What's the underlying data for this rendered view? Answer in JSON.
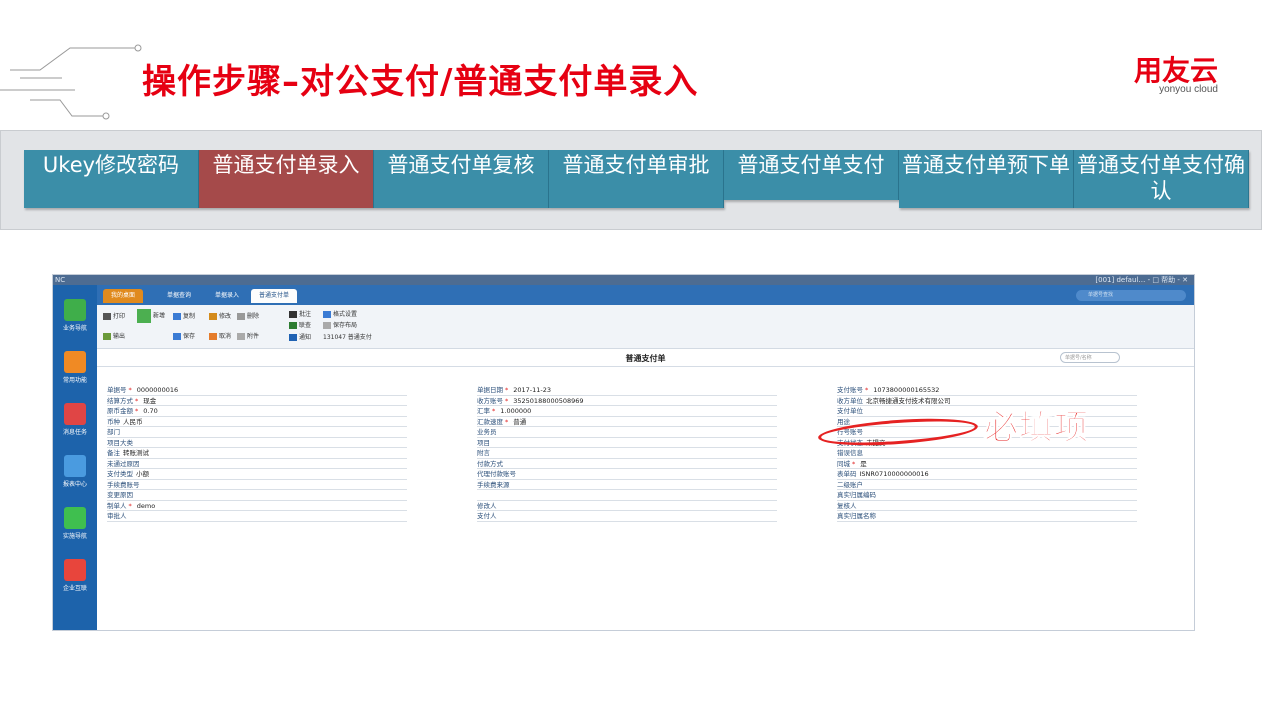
{
  "header": {
    "title": "操作步骤–对公支付/普通支付单录入",
    "logo_main": "用友云",
    "logo_sub": "yonyou cloud"
  },
  "colors": {
    "accent_red": "#e60012",
    "step_blue": "#3b8ea8",
    "step_active": "#a54a4a"
  },
  "steps": [
    {
      "label": "Ukey修改密码",
      "active": false
    },
    {
      "label": "普通支付单录入",
      "active": true
    },
    {
      "label": "普通支付单复核",
      "active": false
    },
    {
      "label": "普通支付单审批",
      "active": false
    },
    {
      "label": "普通支付单支付",
      "active": false
    },
    {
      "label": "普通支付单预下单",
      "active": false
    },
    {
      "label": "普通支付单支付确认",
      "active": false
    }
  ],
  "app": {
    "window_title": "NC",
    "top_right": "[001] defaul… - □ 帮助 - ✕",
    "sidebar": [
      "业务导航",
      "常用功能",
      "消息任务",
      "报表中心",
      "实施导航",
      "企业互联"
    ],
    "tabs": {
      "home": "我的桌面",
      "t1": "单据查询",
      "t2": "单据录入",
      "t3": "普通支付单"
    },
    "tab_search_placeholder": "单据号查找",
    "toolbar": {
      "print": "打印",
      "output": "输出",
      "new": "新增",
      "copy": "复制",
      "edit": "修改",
      "delete": "删除",
      "save": "保存",
      "cancel": "取消",
      "attach": "附件",
      "note": "批注",
      "link": "联查",
      "notice": "通知",
      "format": "格式设置",
      "save_layout": "保存布局",
      "bill": "131047 普通支付"
    },
    "form": {
      "title": "普通支付单",
      "search_placeholder": "单据号/名称",
      "col1": [
        {
          "label": "单据号",
          "req": true,
          "value": "0000000016"
        },
        {
          "label": "结算方式",
          "req": true,
          "value": "现金"
        },
        {
          "label": "原币金额",
          "req": true,
          "value": "0.70"
        },
        {
          "label": "币种",
          "req": false,
          "value": "人民币"
        },
        {
          "label": "部门",
          "req": false,
          "value": ""
        },
        {
          "label": "项目大类",
          "req": false,
          "value": ""
        },
        {
          "label": "备注",
          "req": false,
          "value": "转账测试"
        },
        {
          "label": "未通过原因",
          "req": false,
          "value": ""
        },
        {
          "label": "支付类型",
          "req": false,
          "value": "小额"
        },
        {
          "label": "手续费账号",
          "req": false,
          "value": ""
        },
        {
          "label": "变更原因",
          "req": false,
          "value": ""
        },
        {
          "label": "制单人",
          "req": true,
          "value": "demo"
        },
        {
          "label": "审批人",
          "req": false,
          "value": ""
        }
      ],
      "col2": [
        {
          "label": "单据日期",
          "req": true,
          "value": "2017-11-23"
        },
        {
          "label": "收方账号",
          "req": true,
          "value": "35250188000508969"
        },
        {
          "label": "汇率",
          "req": true,
          "value": "1.000000"
        },
        {
          "label": "汇款速度",
          "req": true,
          "value": "普通"
        },
        {
          "label": "业务员",
          "req": false,
          "value": ""
        },
        {
          "label": "项目",
          "req": false,
          "value": ""
        },
        {
          "label": "附言",
          "req": false,
          "value": ""
        },
        {
          "label": "付款方式",
          "req": false,
          "value": ""
        },
        {
          "label": "代理付款账号",
          "req": false,
          "value": ""
        },
        {
          "label": "手续费来源",
          "req": false,
          "value": ""
        },
        {
          "label": "",
          "req": false,
          "value": ""
        },
        {
          "label": "修改人",
          "req": false,
          "value": ""
        },
        {
          "label": "支付人",
          "req": false,
          "value": ""
        }
      ],
      "col3": [
        {
          "label": "支付账号",
          "req": true,
          "value": "1073800000165532"
        },
        {
          "label": "收方单位",
          "req": false,
          "value": "北京畅捷通支付技术有限公司"
        },
        {
          "label": "支付单位",
          "req": false,
          "value": ""
        },
        {
          "label": "用途",
          "req": false,
          "value": ""
        },
        {
          "label": "行号账号",
          "req": false,
          "value": ""
        },
        {
          "label": "支付状态",
          "req": false,
          "value": "未提交"
        },
        {
          "label": "错误信息",
          "req": false,
          "value": ""
        },
        {
          "label": "同城",
          "req": true,
          "value": "是"
        },
        {
          "label": "表单码",
          "req": false,
          "value": "ISNR0710000000016"
        },
        {
          "label": "二级账户",
          "req": false,
          "value": ""
        },
        {
          "label": "真实归属编码",
          "req": false,
          "value": ""
        },
        {
          "label": "复核人",
          "req": false,
          "value": ""
        },
        {
          "label": "真实归属名称",
          "req": false,
          "value": ""
        }
      ]
    }
  },
  "annotation": {
    "label": "必填项"
  }
}
